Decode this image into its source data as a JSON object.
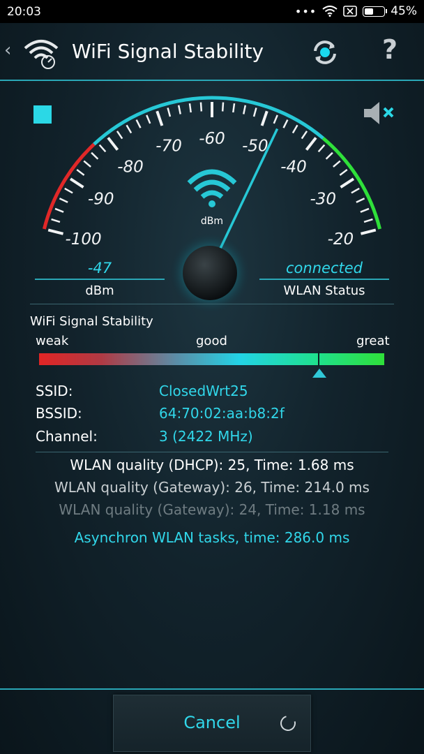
{
  "status_bar": {
    "time": "20:03",
    "battery": "45%",
    "icons": [
      "dots-icon",
      "wifi-icon",
      "sim-off-icon",
      "battery-icon"
    ]
  },
  "header": {
    "back_icon": "‹",
    "title": "WiFi Signal Stability",
    "help": "?"
  },
  "colors": {
    "accent": "#31d7ea",
    "line": "#2aa7b6",
    "weak": "#e12525",
    "great": "#2fe03a"
  },
  "gauge": {
    "scale_labels": [
      "-100",
      "-90",
      "-80",
      "-70",
      "-60",
      "-50",
      "-40",
      "-30",
      "-20"
    ],
    "scale_min": -100,
    "scale_max": -20,
    "needle_value": -47,
    "unit": "dBm"
  },
  "readouts": {
    "dbm": {
      "value": "-47",
      "label": "dBm"
    },
    "status": {
      "value": "connected",
      "label": "WLAN Status"
    }
  },
  "stability": {
    "title": "WiFi Signal Stability",
    "weak": "weak",
    "good": "good",
    "great": "great",
    "level": 0.81
  },
  "info": {
    "ssid_label": "SSID:",
    "ssid": "ClosedWrt25",
    "bssid_label": "BSSID:",
    "bssid": "64:70:02:aa:b8:2f",
    "channel_label": "Channel:",
    "channel": "3 (2422 MHz)"
  },
  "quality": {
    "line1": "WLAN quality (DHCP): 25, Time: 1.68 ms",
    "line2": "WLAN quality (Gateway): 26, Time: 214.0 ms",
    "line3": "WLAN quality (Gateway): 24, Time: 1.18 ms",
    "async": "Asynchron WLAN tasks, time: 286.0 ms"
  },
  "cancel_label": "Cancel"
}
